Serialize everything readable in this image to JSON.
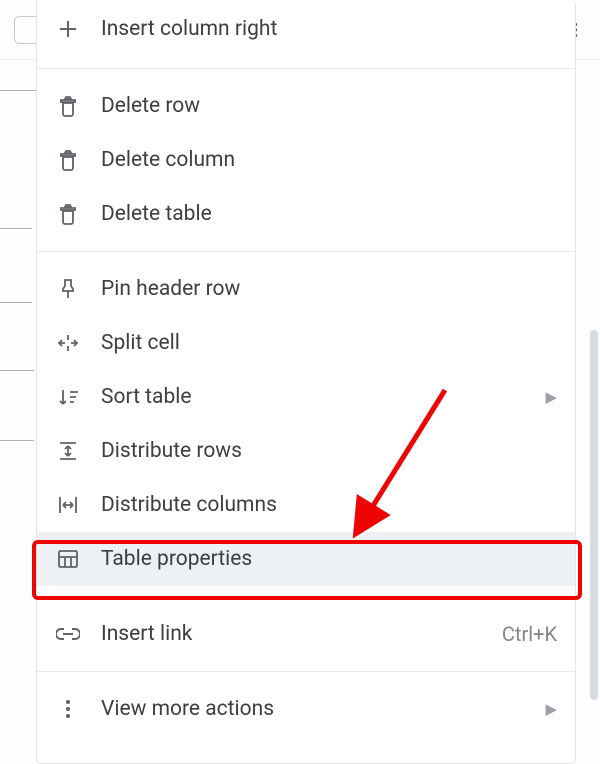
{
  "menu": {
    "insert_column_right": "Insert column right",
    "delete_row": "Delete row",
    "delete_column": "Delete column",
    "delete_table": "Delete table",
    "pin_header_row": "Pin header row",
    "split_cell": "Split cell",
    "sort_table": "Sort table",
    "distribute_rows": "Distribute rows",
    "distribute_columns": "Distribute columns",
    "table_properties": "Table properties",
    "insert_link": "Insert link",
    "insert_link_shortcut": "Ctrl+K",
    "view_more_actions": "View more actions"
  }
}
